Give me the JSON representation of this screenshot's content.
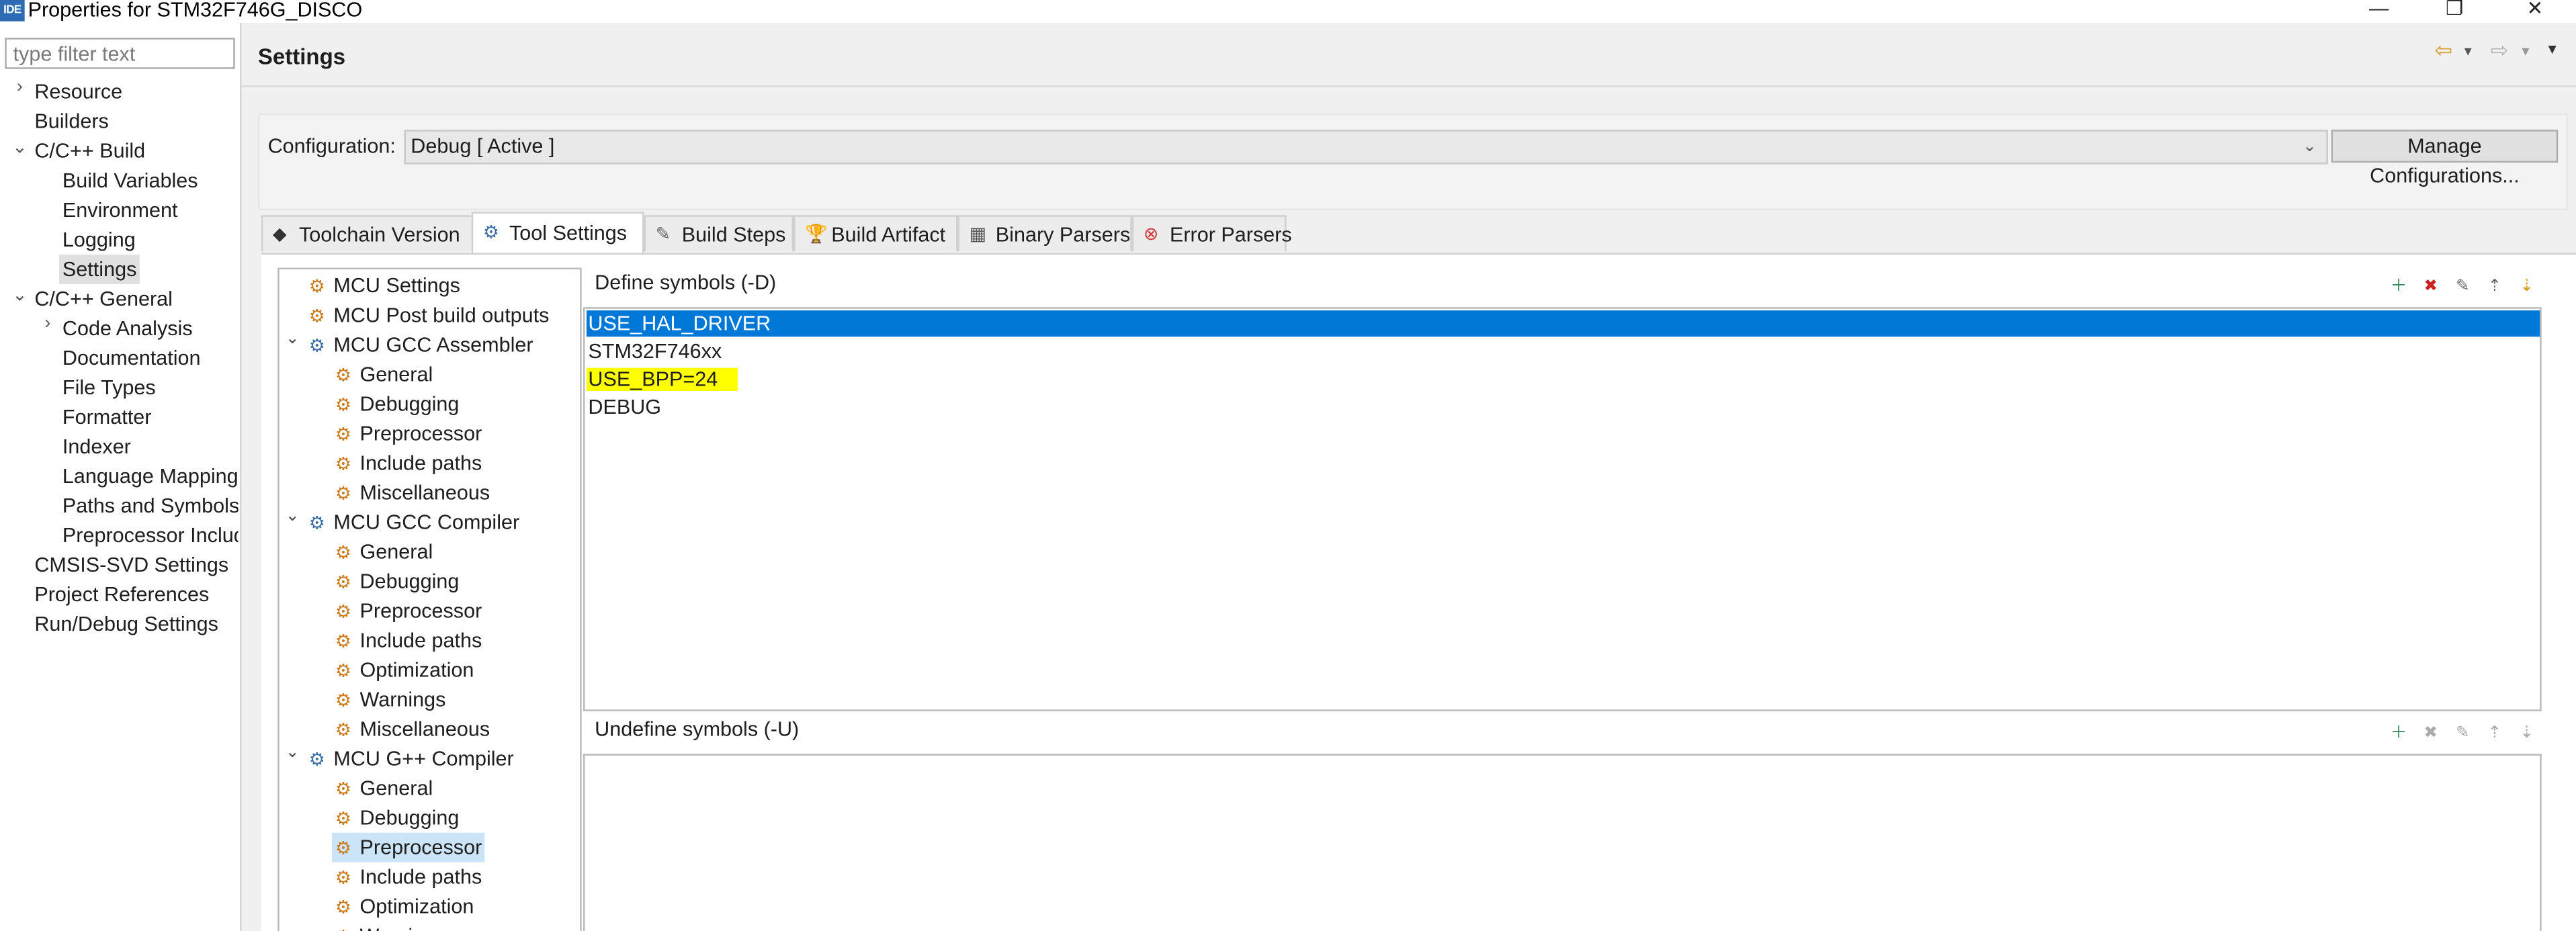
{
  "window": {
    "title": "Properties for STM32F746G_DISCO",
    "logo_text": "IDE",
    "controls": {
      "minimize": "—",
      "restore": "❐",
      "close": "✕"
    }
  },
  "nav": {
    "filter_placeholder": "type filter text",
    "items": [
      {
        "label": "Resource",
        "expander": "›"
      },
      {
        "label": "Builders",
        "expander": ""
      },
      {
        "label": "C/C++ Build",
        "expander": "⌄"
      },
      {
        "label": "Build Variables",
        "expander": ""
      },
      {
        "label": "Environment",
        "expander": ""
      },
      {
        "label": "Logging",
        "expander": ""
      },
      {
        "label": "Settings",
        "expander": ""
      },
      {
        "label": "C/C++ General",
        "expander": "⌄"
      },
      {
        "label": "Code Analysis",
        "expander": "›"
      },
      {
        "label": "Documentation",
        "expander": ""
      },
      {
        "label": "File Types",
        "expander": ""
      },
      {
        "label": "Formatter",
        "expander": ""
      },
      {
        "label": "Indexer",
        "expander": ""
      },
      {
        "label": "Language Mapping",
        "expander": ""
      },
      {
        "label": "Paths and Symbols",
        "expander": ""
      },
      {
        "label": "Preprocessor Include",
        "expander": ""
      },
      {
        "label": "CMSIS-SVD Settings",
        "expander": ""
      },
      {
        "label": "Project References",
        "expander": ""
      },
      {
        "label": "Run/Debug Settings",
        "expander": ""
      }
    ]
  },
  "header": {
    "title": "Settings",
    "back": "⇦",
    "forward": "⇨",
    "dropdown": "▾",
    "menu": "▾"
  },
  "config": {
    "label": "Configuration:",
    "value": "Debug  [ Active ]",
    "manage_label": "Manage Configurations..."
  },
  "tabs": [
    {
      "label": "Toolchain  Version",
      "icon": "◆"
    },
    {
      "label": "Tool Settings",
      "icon": "⚙"
    },
    {
      "label": "Build Steps",
      "icon": "✎"
    },
    {
      "label": "Build Artifact",
      "icon": "🏆"
    },
    {
      "label": "Binary Parsers",
      "icon": "▦"
    },
    {
      "label": "Error Parsers",
      "icon": "⊗"
    }
  ],
  "tool_tree": [
    {
      "label": "MCU Settings",
      "expander": ""
    },
    {
      "label": "MCU Post build outputs",
      "expander": ""
    },
    {
      "label": "MCU GCC Assembler",
      "expander": "⌄"
    },
    {
      "label": "General",
      "expander": ""
    },
    {
      "label": "Debugging",
      "expander": ""
    },
    {
      "label": "Preprocessor",
      "expander": ""
    },
    {
      "label": "Include paths",
      "expander": ""
    },
    {
      "label": "Miscellaneous",
      "expander": ""
    },
    {
      "label": "MCU GCC Compiler",
      "expander": "⌄"
    },
    {
      "label": "General",
      "expander": ""
    },
    {
      "label": "Debugging",
      "expander": ""
    },
    {
      "label": "Preprocessor",
      "expander": ""
    },
    {
      "label": "Include paths",
      "expander": ""
    },
    {
      "label": "Optimization",
      "expander": ""
    },
    {
      "label": "Warnings",
      "expander": ""
    },
    {
      "label": "Miscellaneous",
      "expander": ""
    },
    {
      "label": "MCU G++ Compiler",
      "expander": "⌄"
    },
    {
      "label": "General",
      "expander": ""
    },
    {
      "label": "Debugging",
      "expander": ""
    },
    {
      "label": "Preprocessor",
      "expander": ""
    },
    {
      "label": "Include paths",
      "expander": ""
    },
    {
      "label": "Optimization",
      "expander": ""
    },
    {
      "label": "Warnings",
      "expander": ""
    }
  ],
  "define_symbols": {
    "title": "Define symbols (-D)",
    "items": [
      "USE_HAL_DRIVER",
      "STM32F746xx",
      "USE_BPP=24",
      "DEBUG"
    ]
  },
  "undefine_symbols": {
    "title": "Undefine symbols (-U)",
    "items": []
  },
  "list_tools": {
    "add": "＋",
    "delete": "✖",
    "edit": "✎",
    "move_up": "⇡",
    "move_down": "⇣"
  },
  "colors": {
    "selection": "#0078d7",
    "highlight": "#ffff00",
    "tree_selection": "#cce4f7"
  }
}
